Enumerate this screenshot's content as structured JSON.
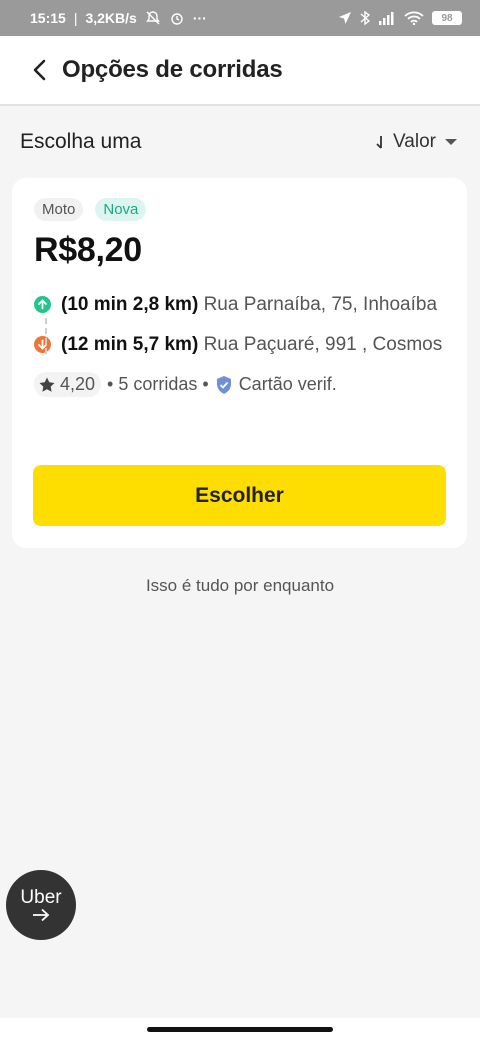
{
  "status": {
    "time": "15:15",
    "speed": "3,2KB/s",
    "dots": "···",
    "battery": "98"
  },
  "header": {
    "title": "Opções de corridas"
  },
  "sort": {
    "title": "Escolha uma",
    "label": "Valor"
  },
  "card": {
    "tag_type": "Moto",
    "tag_new": "Nova",
    "price": "R$8,20",
    "pickup": {
      "eta": "(10 min 2,8 km)",
      "address": "Rua Parnaíba, 75, Inhoaíba"
    },
    "dropoff": {
      "eta": "(12 min 5,7 km)",
      "address": "Rua Paçuaré, 991 , Cosmos"
    },
    "rating": "4,20",
    "rides": "• 5 corridas •",
    "card_status": "Cartão verif.",
    "button_label": "Escolher"
  },
  "footer_note": "Isso é tudo por enquanto",
  "bubble": {
    "label": "Uber"
  },
  "colors": {
    "accent": "#fede00",
    "pickup": "#22c58b",
    "dropoff": "#f17437",
    "verified": "#6f8fd8"
  }
}
